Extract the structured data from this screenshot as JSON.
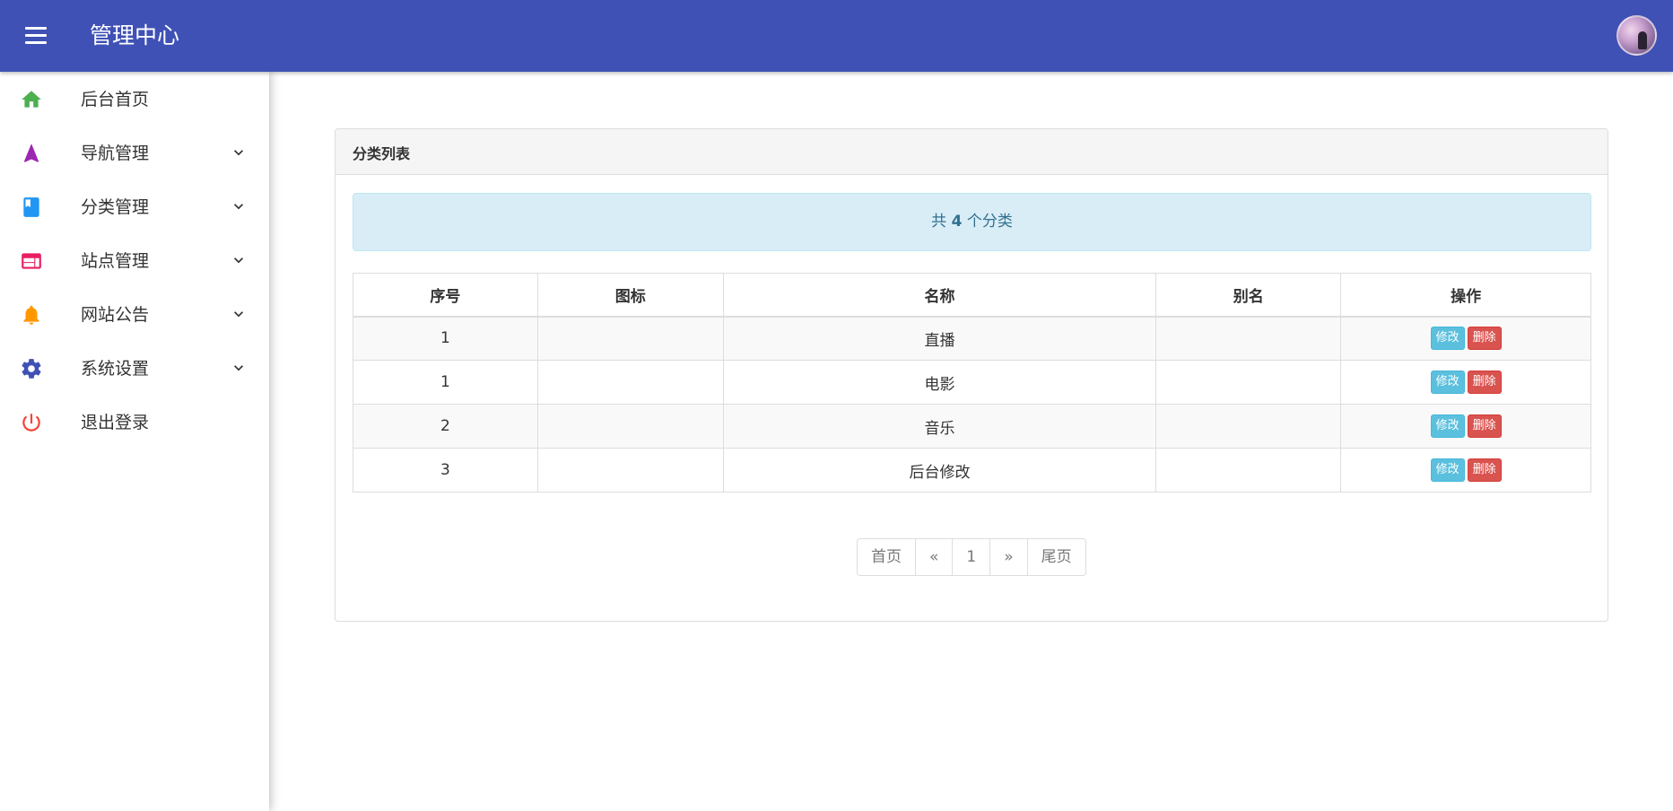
{
  "header": {
    "title": "管理中心",
    "accent_color": "#3f51b5"
  },
  "sidebar": {
    "items": [
      {
        "label": "后台首页",
        "icon": "home-icon",
        "color": "#4caf50",
        "has_submenu": false
      },
      {
        "label": "导航管理",
        "icon": "navigation-icon",
        "color": "#9c27b0",
        "has_submenu": true
      },
      {
        "label": "分类管理",
        "icon": "book-icon",
        "color": "#2196f3",
        "has_submenu": true
      },
      {
        "label": "站点管理",
        "icon": "web-icon",
        "color": "#e91e63",
        "has_submenu": true
      },
      {
        "label": "网站公告",
        "icon": "bell-icon",
        "color": "#ff9800",
        "has_submenu": true
      },
      {
        "label": "系统设置",
        "icon": "gear-icon",
        "color": "#3f51b5",
        "has_submenu": true
      },
      {
        "label": "退出登录",
        "icon": "power-icon",
        "color": "#f44336",
        "has_submenu": false
      }
    ]
  },
  "panel": {
    "title": "分类列表",
    "summary_prefix": "共",
    "summary_count": "4",
    "summary_suffix": "个分类"
  },
  "table": {
    "columns": [
      "序号",
      "图标",
      "名称",
      "别名",
      "操作"
    ],
    "rows": [
      {
        "index": "1",
        "icon": "",
        "name": "直播",
        "alias": ""
      },
      {
        "index": "1",
        "icon": "",
        "name": "电影",
        "alias": ""
      },
      {
        "index": "2",
        "icon": "",
        "name": "音乐",
        "alias": ""
      },
      {
        "index": "3",
        "icon": "",
        "name": "后台修改",
        "alias": ""
      }
    ],
    "edit_label": "修改",
    "delete_label": "删除"
  },
  "pagination": {
    "first": "首页",
    "prev": "«",
    "current": "1",
    "next": "»",
    "last": "尾页"
  }
}
